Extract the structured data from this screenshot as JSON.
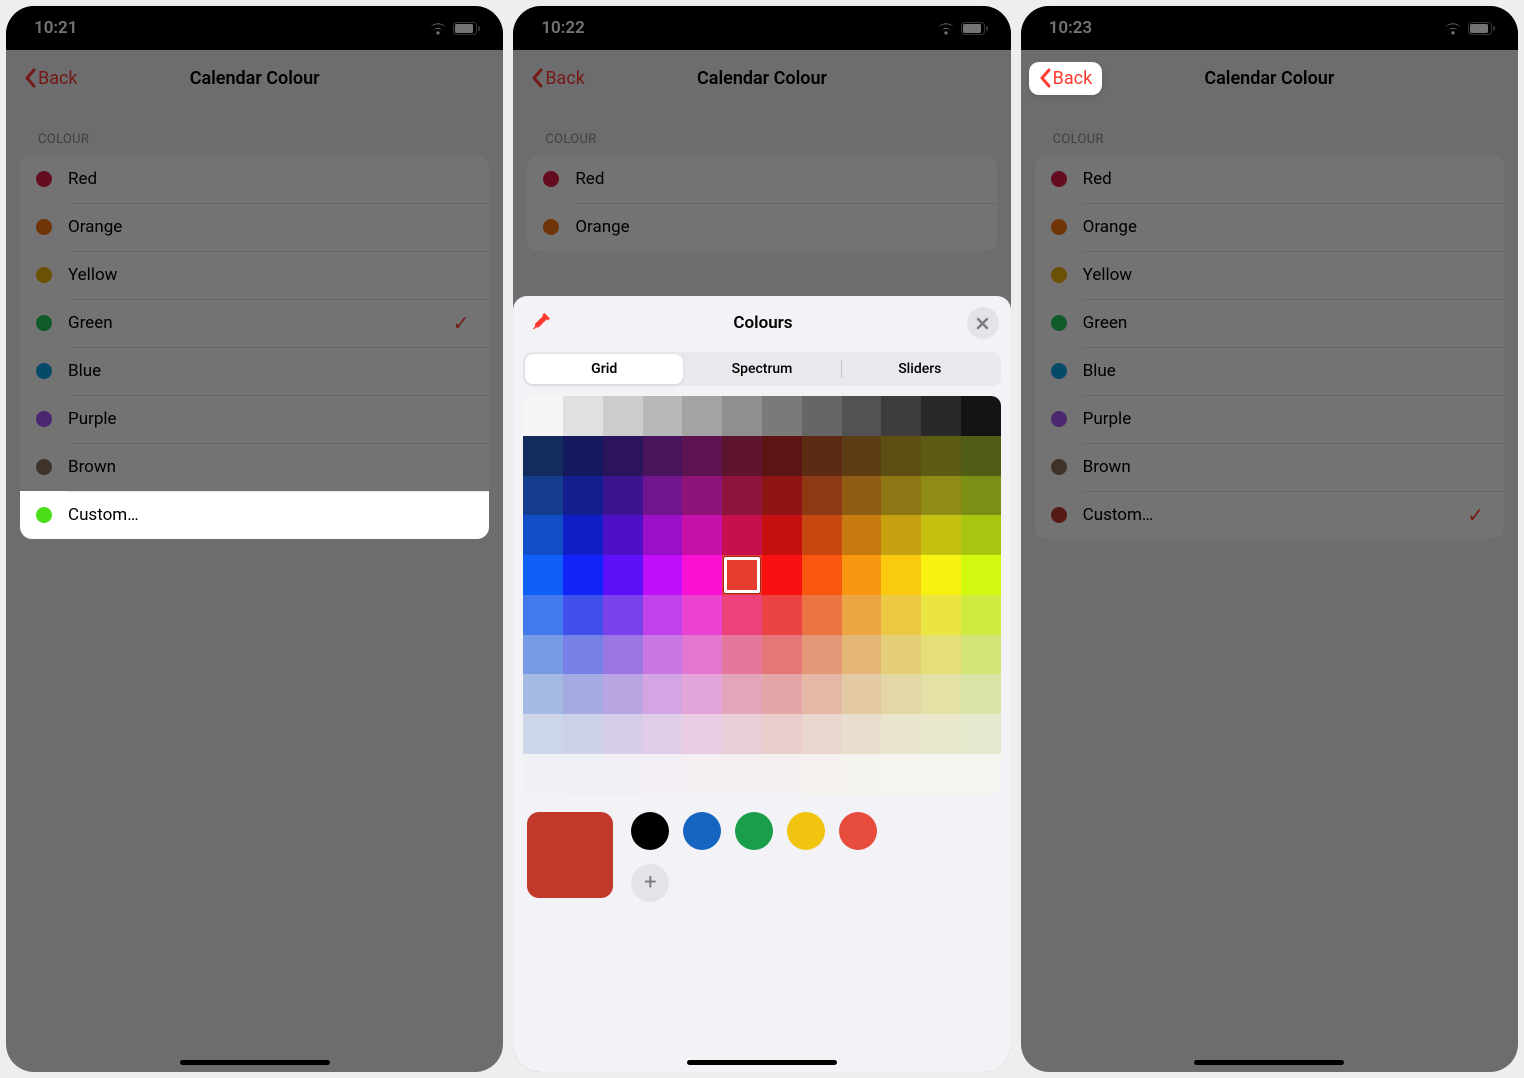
{
  "screens": [
    {
      "time": "10:21"
    },
    {
      "time": "10:22"
    },
    {
      "time": "10:23"
    }
  ],
  "nav": {
    "back": "Back",
    "title": "Calendar Colour"
  },
  "section_header": "COLOUR",
  "colours": [
    {
      "label": "Red",
      "hex": "#e11d48"
    },
    {
      "label": "Orange",
      "hex": "#f97316"
    },
    {
      "label": "Yellow",
      "hex": "#eab308"
    },
    {
      "label": "Green",
      "hex": "#22c55e"
    },
    {
      "label": "Blue",
      "hex": "#0ea5e9"
    },
    {
      "label": "Purple",
      "hex": "#a855f7"
    },
    {
      "label": "Brown",
      "hex": "#8b6f5c"
    }
  ],
  "custom_label": "Custom…",
  "screen1": {
    "selected_index": 3,
    "custom_swatch": "#4ade1a",
    "highlight_custom": true
  },
  "screen3": {
    "selected_custom": true,
    "custom_swatch": "#c0392b",
    "back_highlighted": true
  },
  "picker": {
    "title": "Colours",
    "tabs": [
      "Grid",
      "Spectrum",
      "Sliders"
    ],
    "selected_tab": 0,
    "selected_cell": {
      "row": 4,
      "col": 5
    },
    "current": "#c0392b",
    "recent": [
      "#000000",
      "#1565c0",
      "#1b9e4b",
      "#f1c40f",
      "#e74c3c"
    ],
    "behind_colours_shown": [
      "Red",
      "Orange"
    ]
  }
}
